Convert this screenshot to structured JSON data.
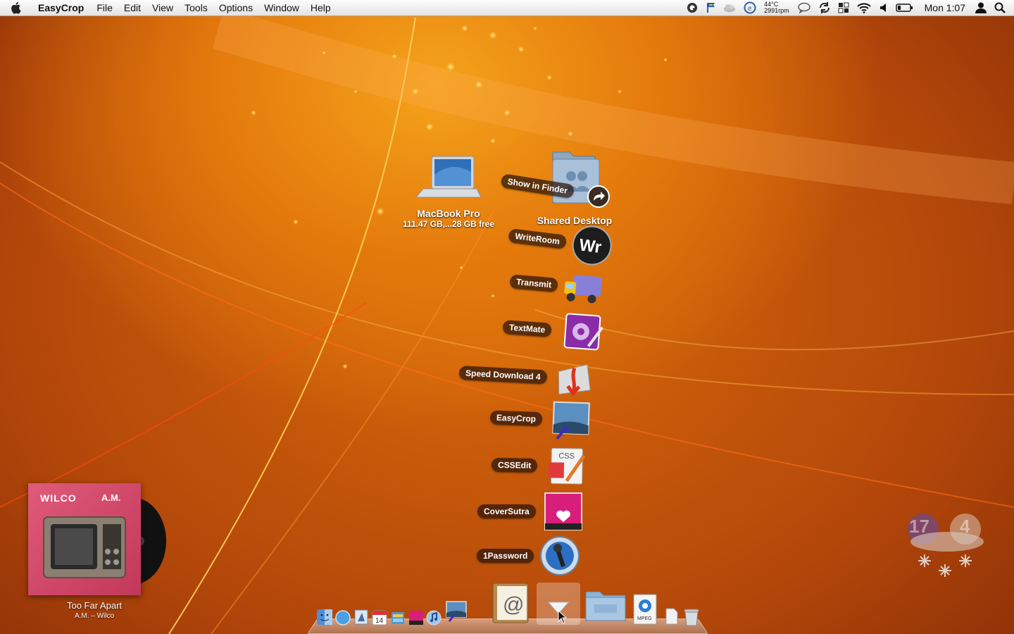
{
  "menubar": {
    "apple": "apple-menu",
    "app_name": "EasyCrop",
    "items": [
      "File",
      "Edit",
      "View",
      "Tools",
      "Options",
      "Window",
      "Help"
    ],
    "status": {
      "temperature": "44°C",
      "fan": "2991rpm",
      "clock": "Mon 1:07"
    }
  },
  "desktop": {
    "macbook": {
      "name": "MacBook Pro",
      "sub": "111.47 GB,...28 GB free"
    },
    "shared": {
      "name": "Shared Desktop"
    }
  },
  "stack": {
    "show_in_finder": "Show in Finder",
    "items": [
      {
        "label": "WriteRoom",
        "icon": "writeroom-icon"
      },
      {
        "label": "Transmit",
        "icon": "transmit-icon"
      },
      {
        "label": "TextMate",
        "icon": "textmate-icon"
      },
      {
        "label": "Speed Download 4",
        "icon": "speed-download-icon"
      },
      {
        "label": "EasyCrop",
        "icon": "easycrop-icon"
      },
      {
        "label": "CSSEdit",
        "icon": "cssedit-icon"
      },
      {
        "label": "CoverSutra",
        "icon": "coversutra-icon"
      },
      {
        "label": "1Password",
        "icon": "1password-icon"
      }
    ]
  },
  "nowplaying": {
    "band": "WILCO",
    "album": "A.M.",
    "track": "Too Far Apart",
    "artist_line": "A.M. – Wilco"
  },
  "ical_widget": {
    "day_a": "17",
    "day_b": "4"
  },
  "cssedit_badge": "CSS",
  "calendar_day": "14",
  "mpeg_label": "MPEG",
  "colors": {
    "accent": "#e47a0c",
    "dark_label": "#2a140a"
  }
}
